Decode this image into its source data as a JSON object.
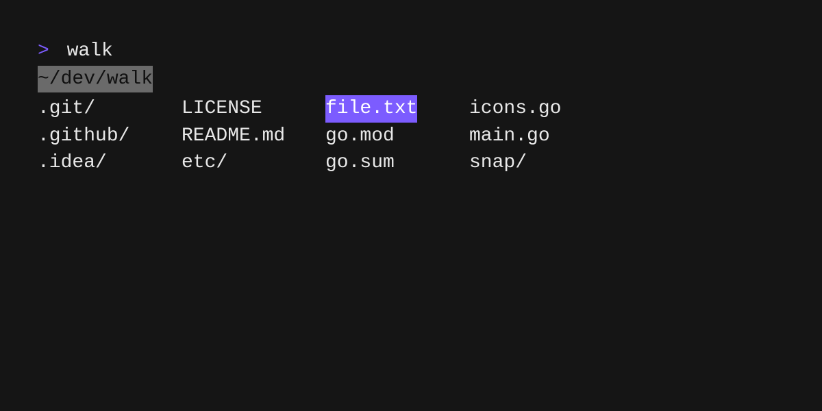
{
  "prompt": {
    "symbol": ">",
    "command": "walk"
  },
  "cwd": "~/dev/walk",
  "selected": "file.txt",
  "columns": [
    [
      ".git/",
      ".github/",
      ".idea/"
    ],
    [
      "LICENSE",
      "README.md",
      "etc/"
    ],
    [
      "file.txt",
      "go.mod",
      "go.sum"
    ],
    [
      "icons.go",
      "main.go",
      "snap/"
    ]
  ],
  "colors": {
    "background": "#151515",
    "text": "#e8e8e8",
    "accent": "#7c5cff",
    "cwd_bg": "#6a6a6a"
  }
}
